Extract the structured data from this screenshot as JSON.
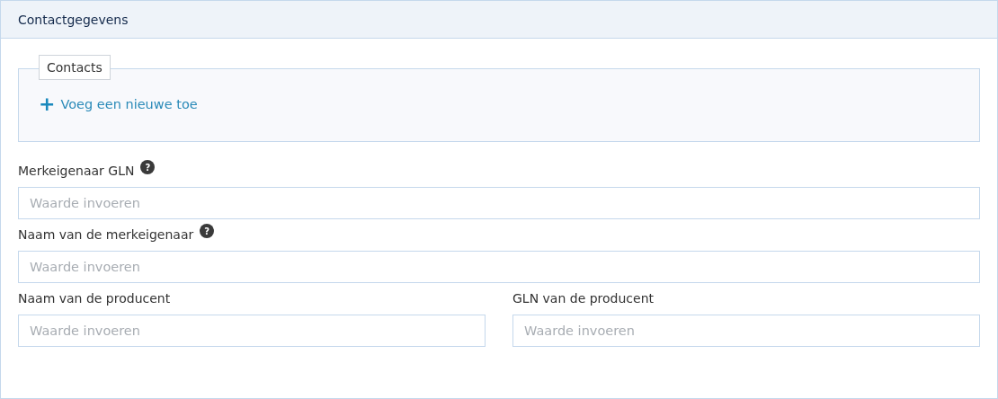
{
  "panel": {
    "title": "Contactgegevens"
  },
  "contacts": {
    "legend": "Contacts",
    "add_icon": "+",
    "add_link": "Voeg een nieuwe toe"
  },
  "field_rows": [
    {
      "fields": [
        {
          "label": "Merkeigenaar GLN",
          "help": "?",
          "placeholder": "Waarde invoeren"
        }
      ]
    },
    {
      "fields": [
        {
          "label": "Naam van de merkeigenaar",
          "help": "?",
          "placeholder": "Waarde invoeren"
        }
      ]
    },
    {
      "fields": [
        {
          "label": "Naam van de producent",
          "placeholder": "Waarde invoeren"
        },
        {
          "label": "GLN van de producent",
          "placeholder": "Waarde invoeren"
        }
      ]
    }
  ]
}
